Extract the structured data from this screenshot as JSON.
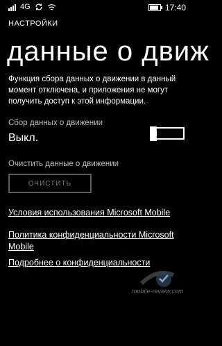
{
  "status": {
    "network": "4G",
    "time": "17:40",
    "signal_bars": 4,
    "battery_level": 0.85
  },
  "app_title": "НАСТРОЙКИ",
  "page_title": "данные о движ",
  "description": "Функция сбора данных о движении в данный момент отключена, и приложения не могут получить доступ к этой информации.",
  "motion_setting": {
    "label": "Сбор данных о движении",
    "value": "Выкл.",
    "on": false
  },
  "clear": {
    "label": "Очистить данные о движении",
    "button": "ОЧИСТИТЬ"
  },
  "links": [
    "Условия использования Microsoft Mobile",
    "Политика конфиденциальности Microsoft Mobile",
    "Подробнее о конфиденциальности"
  ],
  "watermark": "mobile-review.com",
  "colors": {
    "background": "#000000",
    "foreground": "#ffffff",
    "secondary": "#bdbdbd",
    "disabled": "#5a5a5a"
  },
  "icons": [
    "signal-icon",
    "network-icon",
    "sync-icon",
    "wifi-icon",
    "battery-icon"
  ]
}
